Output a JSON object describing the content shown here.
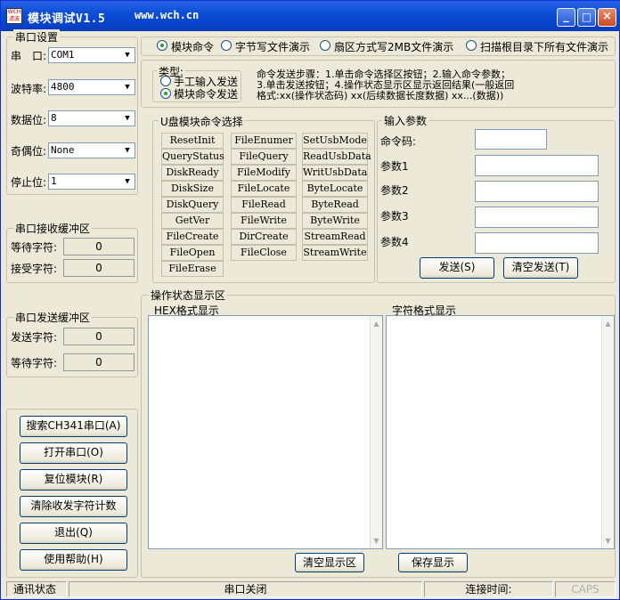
{
  "window": {
    "title": "模块调试V1.5",
    "url": "www.wch.cn",
    "icon_text": "WCH 滤波",
    "controls": {
      "minimize": "_",
      "maximize": "□",
      "close": "×"
    }
  },
  "serial_setup": {
    "group_label": "串口设置",
    "port_label": "串　口:",
    "port_value": "COM1",
    "baud_label": "波特率:",
    "baud_value": "4800",
    "databits_label": "数据位:",
    "databits_value": "8",
    "parity_label": "奇偶位:",
    "parity_value": "None",
    "stopbits_label": "停止位:",
    "stopbits_value": "1"
  },
  "rx_buffer": {
    "group_label": "串口接收缓冲区",
    "waiting_label": "等待字符:",
    "waiting_value": "0",
    "received_label": "接受字符:",
    "received_value": "0"
  },
  "tx_buffer": {
    "group_label": "串口发送缓冲区",
    "sent_label": "发送字符:",
    "sent_value": "0",
    "waiting_label": "等待字符:",
    "waiting_value": "0"
  },
  "left_buttons": {
    "search": "搜索CH341串口(A)",
    "open": "打开串口(O)",
    "reset": "复位模块(R)",
    "clear_count": "清除收发字符计数",
    "exit": "退出(Q)",
    "help": "使用帮助(H)"
  },
  "mode_tabs": [
    {
      "label": "模块命令",
      "selected": true
    },
    {
      "label": "字节写文件演示",
      "selected": false
    },
    {
      "label": "扇区方式写2MB文件演示",
      "selected": false
    },
    {
      "label": "扫描根目录下所有文件演示",
      "selected": false
    }
  ],
  "type_group": {
    "label": "类型:",
    "manual": "手工输入发送",
    "module": "模块命令发送"
  },
  "steps_text": {
    "line1": "命令发送步骤：1.单击命令选择区按钮；2.输入命令参数；",
    "line2": "3.单击发送按钮；4.操作状态显示区显示返回结果(一般返回",
    "line3": "格式:xx(操作状态码) xx(后续数据长度数据) xx...(数据))"
  },
  "command_group": {
    "label": "U盘模块命令选择",
    "commands": [
      "ResetInit",
      "FileEnumer",
      "SetUsbMode",
      "QueryStatus",
      "FileQuery",
      "ReadUsbData",
      "DiskReady",
      "FileModify",
      "WritUsbData",
      "DiskSize",
      "FileLocate",
      "ByteLocate",
      "DiskQuery",
      "FileRead",
      "ByteRead",
      "GetVer",
      "FileWrite",
      "ByteWrite",
      "FileCreate",
      "DirCreate",
      "StreamRead",
      "FileOpen",
      "FileClose",
      "StreamWrite",
      "FileErase"
    ]
  },
  "input_params": {
    "label": "输入参数",
    "cmd_code_label": "命令码:",
    "param1_label": "参数1",
    "param2_label": "参数2",
    "param3_label": "参数3",
    "param4_label": "参数4",
    "send_button": "发送(S)",
    "clear_button": "清空发送(T)"
  },
  "status_display": {
    "label": "操作状态显示区",
    "hex_label": "HEX格式显示",
    "char_label": "字符格式显示",
    "clear_button": "清空显示区",
    "save_button": "保存显示"
  },
  "statusbar": {
    "comm_state": "通讯状态",
    "port_state": "串口关闭",
    "connect_time": "连接时间:",
    "caps": "CAPS"
  }
}
